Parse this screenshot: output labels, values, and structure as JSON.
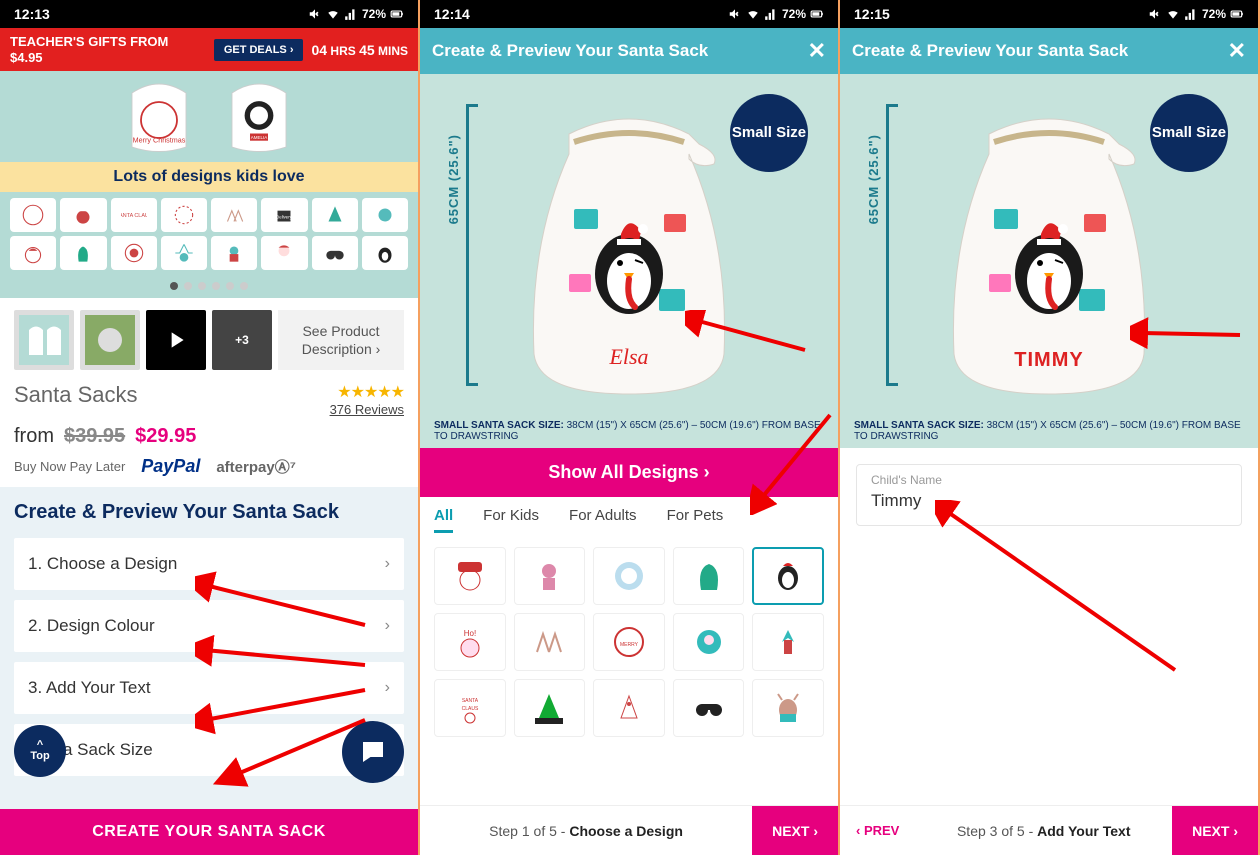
{
  "status_bar": {
    "s1_time": "12:13",
    "s2_time": "12:14",
    "s3_time": "12:15",
    "battery": "72%"
  },
  "promo": {
    "text_line1": "TEACHER'S GIFTS FROM",
    "text_line2": "$4.95",
    "button": "GET DEALS ›",
    "hours_num": "04",
    "hours_label": " HRS ",
    "mins_num": "45",
    "mins_label": " MINS"
  },
  "hero": {
    "designs_label": "Lots of designs kids love",
    "more_count": "+3",
    "see_desc": "See Product Description ›"
  },
  "product": {
    "title": "Santa Sacks",
    "reviews": "376 Reviews",
    "from": "from",
    "old_price": "$39.95",
    "new_price": "$29.95",
    "bnpl": "Buy Now Pay Later",
    "paypal": "PayPal",
    "afterpay": "afterpayⒶ⁷"
  },
  "steps": {
    "title": "Create & Preview Your Santa Sack",
    "s1": "1. Choose a Design",
    "s2": "2. Design Colour",
    "s3": "3. Add Your Text",
    "s4": "Santa Sack Size",
    "top": "Top",
    "cta": "CREATE YOUR SANTA SACK"
  },
  "modal": {
    "title": "Create & Preview Your Santa Sack",
    "size_badge": "Small Size",
    "height": "65CM (25.6\")",
    "footnote_bold": "SMALL SANTA SACK SIZE:",
    "footnote_rest": " 38CM (15\") X 65CM (25.6\") – 50CM (19.6\") FROM BASE TO DRAWSTRING",
    "show_all": "Show All Designs ›"
  },
  "tabs": {
    "all": "All",
    "kids": "For Kids",
    "adults": "For Adults",
    "pets": "For Pets"
  },
  "sack_names": {
    "s2": "Elsa",
    "s3": "TIMMY"
  },
  "name_input": {
    "label": "Child's Name",
    "value": "Timmy"
  },
  "footer": {
    "s2_step_pre": "Step 1 of 5 - ",
    "s2_step_bold": "Choose a Design",
    "s3_step_pre": "Step 3 of 5 - ",
    "s3_step_bold": "Add Your Text",
    "next": "NEXT ›",
    "prev": "‹ PREV"
  }
}
